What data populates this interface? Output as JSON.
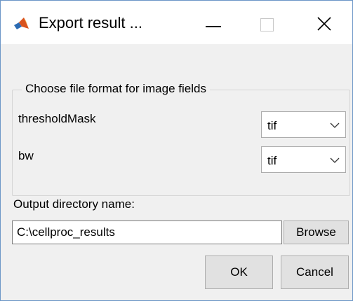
{
  "window": {
    "title": "Export result ...",
    "app_icon": "matlab-icon",
    "controls": {
      "minimize_icon": "minimize-icon",
      "maximize_icon": "maximize-icon",
      "close_icon": "close-icon"
    }
  },
  "image_format_group": {
    "legend": "Choose file format for image fields",
    "fields": [
      {
        "label": "thresholdMask",
        "selected": "tif"
      },
      {
        "label": "bw",
        "selected": "tif"
      }
    ]
  },
  "output": {
    "label": "Output directory name:",
    "value": "C:\\cellproc_results",
    "browse_label": "Browse"
  },
  "buttons": {
    "ok_label": "OK",
    "cancel_label": "Cancel"
  },
  "colors": {
    "dialog_background": "#f0f0f0",
    "title_bar": "#ffffff",
    "window_border": "#6b96c7",
    "button_face": "#e1e1e1"
  }
}
